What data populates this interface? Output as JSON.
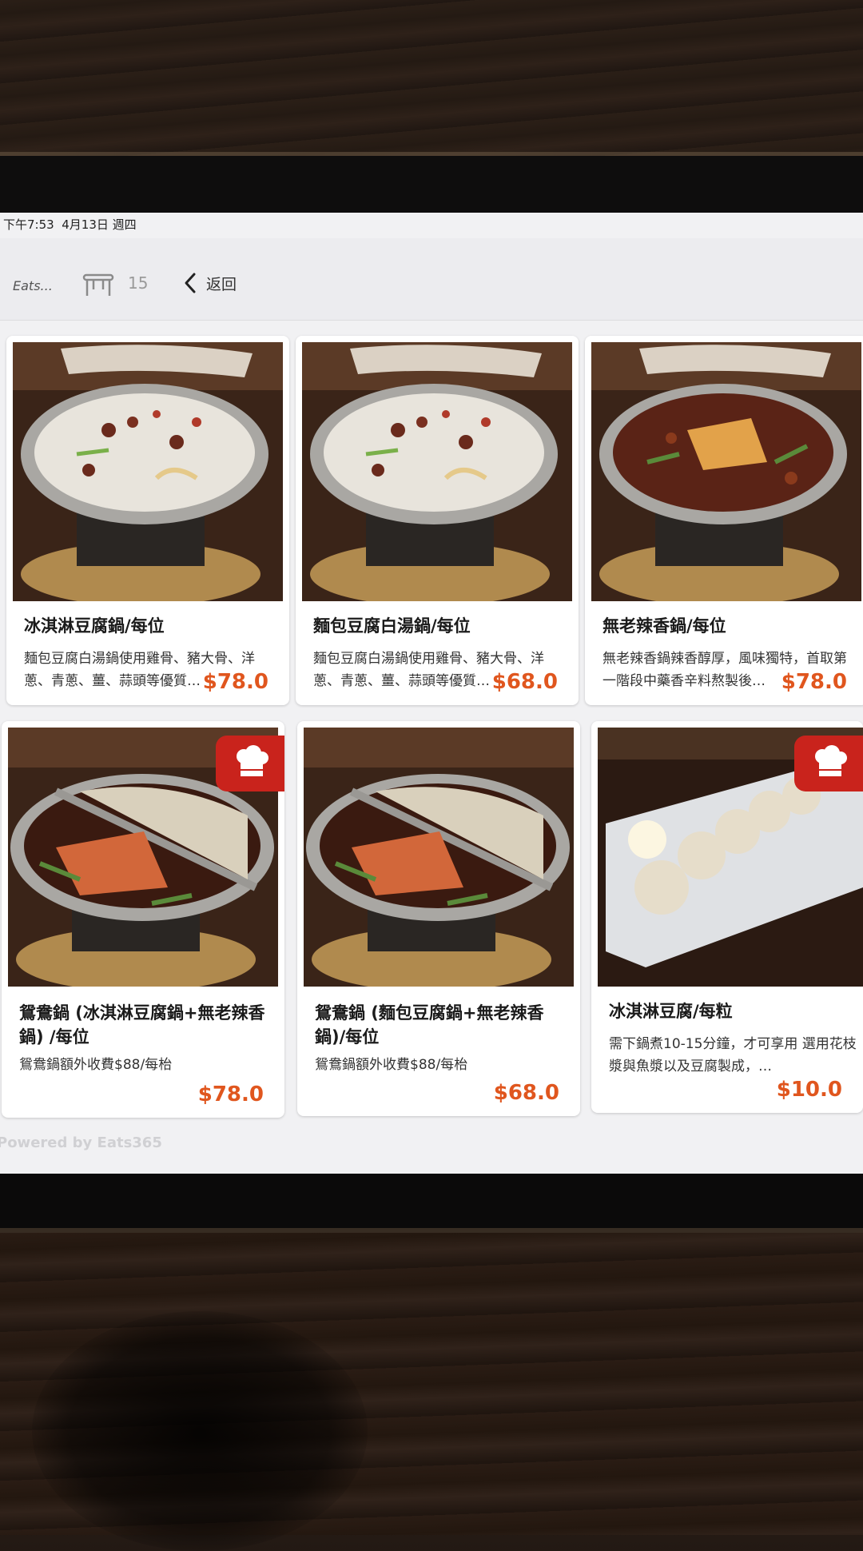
{
  "status_bar": {
    "time": "下午7:53",
    "date": "4月13日 週四"
  },
  "header": {
    "logo_text": "Eats...",
    "table_number": "15",
    "back_label": "返回"
  },
  "menu_items": [
    {
      "name": "冰淇淋豆腐鍋/每位",
      "description": "麵包豆腐白湯鍋使用雞骨、豬大骨、洋蔥、青蔥、薑、蒜頭等優質…",
      "price": "$78.0",
      "photo": "white-broth-hotpot",
      "chef_badge": false
    },
    {
      "name": "麵包豆腐白湯鍋/每位",
      "description": "麵包豆腐白湯鍋使用雞骨、豬大骨、洋蔥、青蔥、薑、蒜頭等優質…",
      "price": "$68.0",
      "photo": "white-broth-hotpot",
      "chef_badge": false
    },
    {
      "name": "無老辣香鍋/每位",
      "description": "無老辣香鍋辣香醇厚，風味獨特，首取第一階段中藥香辛料熬製後…",
      "price": "$78.0",
      "photo": "spicy-broth-hotpot",
      "chef_badge": false
    },
    {
      "name": "鴛鴦鍋 (冰淇淋豆腐鍋+無老辣香鍋) /每位",
      "description": "鴛鴦鍋額外收費$88/每枱",
      "price": "$78.0",
      "photo": "yuanyang-hotpot",
      "chef_badge": true
    },
    {
      "name": "鴛鴦鍋 (麵包豆腐鍋+無老辣香鍋)/每位",
      "description": "鴛鴦鍋額外收費$88/每枱",
      "price": "$68.0",
      "photo": "yuanyang-hotpot",
      "chef_badge": true
    },
    {
      "name": "冰淇淋豆腐/每粒",
      "description": "需下鍋煮10-15分鐘，才可享用 選用花枝漿與魚漿以及豆腐製成，…",
      "price": "$10.0",
      "photo": "ice-cream-tofu-plate",
      "chef_badge": true
    }
  ],
  "footer": {
    "powered_by": "Powered by Eats365"
  },
  "colors": {
    "price": "#e0561e",
    "badge": "#c9231c",
    "screen_bg": "#f1f1f3"
  }
}
